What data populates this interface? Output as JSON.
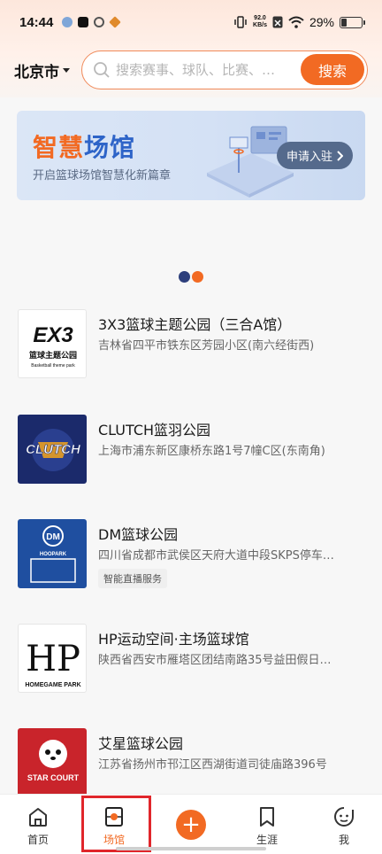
{
  "status_bar": {
    "time": "14:44",
    "speed_value": "92.0",
    "speed_unit": "KB/s",
    "battery_pct": "29%",
    "battery_level": 0.29
  },
  "header": {
    "city": "北京市",
    "search_placeholder": "搜索赛事、球队、比赛、…",
    "search_button": "搜索"
  },
  "banner": {
    "title_part1": "智慧",
    "title_part2": "场馆",
    "subtitle": "开启篮球场馆智慧化新篇章",
    "button_label": "申请入驻"
  },
  "carousel": {
    "slide_count": 2,
    "active_index": 1
  },
  "venues": [
    {
      "name": "3X3篮球主题公园（三合A馆）",
      "address": "吉林省四平市铁东区芳园小区(南六经街西)",
      "tag": "",
      "logo_text": "EX3",
      "logo_sub": "篮球主题公园",
      "logo_sub2": "Basketball theme park"
    },
    {
      "name": "CLUTCH篮羽公园",
      "address": "上海市浦东新区康桥东路1号7幢C区(东南角)",
      "tag": "",
      "logo_text": "CLUTCH"
    },
    {
      "name": "DM篮球公园",
      "address": "四川省成都市武侯区天府大道中段SKPS停车…",
      "tag": "智能直播服务",
      "logo_text": "DM",
      "logo_sub": "HOOPARK"
    },
    {
      "name": "HP运动空间·主场篮球馆",
      "address": "陕西省西安市雁塔区团结南路35号益田假日…",
      "tag": "",
      "logo_text": "HP",
      "logo_sub": "HOMEGAME PARK"
    },
    {
      "name": "艾星篮球公园",
      "address": "江苏省扬州市邗江区西湖街道司徒庙路396号",
      "tag": "",
      "logo_text": "STAR COURT"
    }
  ],
  "nav": {
    "items": [
      {
        "label": "首页",
        "icon": "home-icon"
      },
      {
        "label": "场馆",
        "icon": "venue-icon"
      },
      {
        "label": "",
        "icon": "add-icon"
      },
      {
        "label": "生涯",
        "icon": "career-icon"
      },
      {
        "label": "我",
        "icon": "profile-icon"
      }
    ],
    "active_index": 1
  },
  "colors": {
    "accent": "#f26a23",
    "brand_blue": "#2e64c8",
    "highlight_red": "#e0262b"
  }
}
